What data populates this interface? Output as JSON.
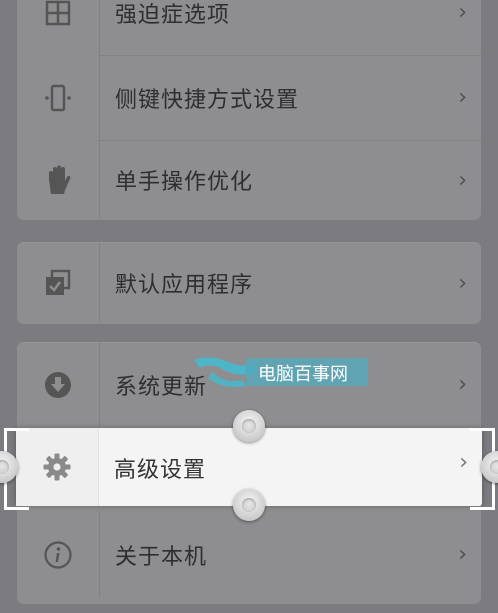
{
  "items": [
    {
      "label": "强迫症选项",
      "icon": "grid-icon"
    },
    {
      "label": "侧键快捷方式设置",
      "icon": "side-key-icon"
    },
    {
      "label": "单手操作优化",
      "icon": "hand-icon"
    },
    {
      "label": "默认应用程序",
      "icon": "default-apps-icon"
    },
    {
      "label": "系统更新",
      "icon": "download-icon"
    },
    {
      "label": "高级设置",
      "icon": "gear-icon"
    },
    {
      "label": "关于本机",
      "icon": "info-icon"
    }
  ],
  "chevron": "›",
  "watermark": {
    "text": "电脑百事网"
  }
}
